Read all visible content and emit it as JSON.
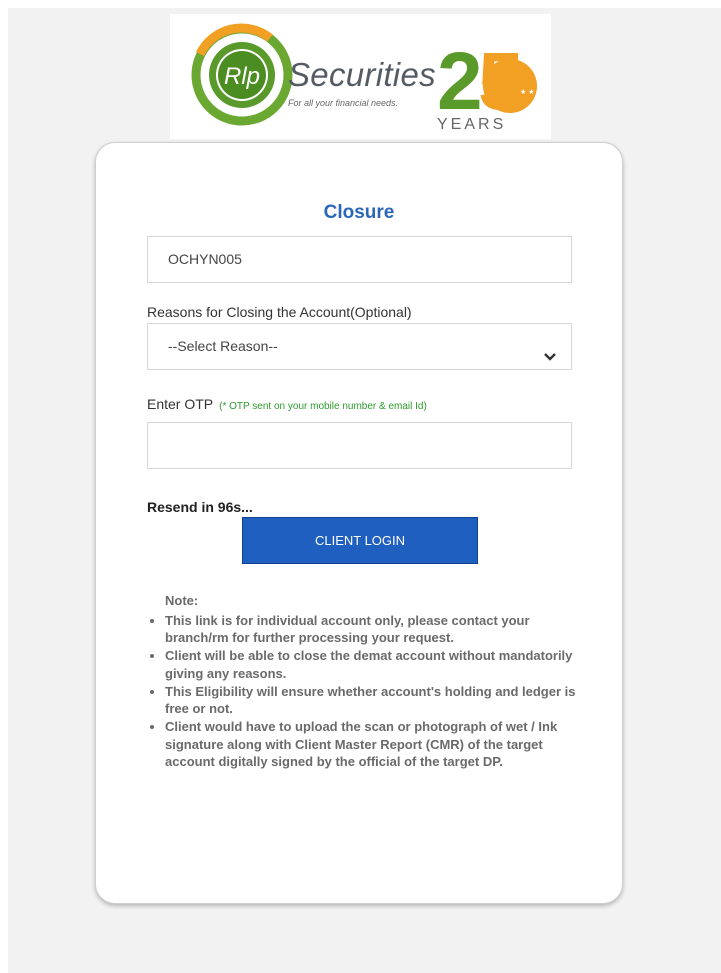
{
  "logo": {
    "brand": "Securities",
    "monogram": "Rlp",
    "tagline": "For all your financial needs.",
    "anniversary": "25",
    "years": "YEARS",
    "colors": {
      "green": "#5a9a2a",
      "orange": "#f2a024",
      "grey": "#555b63"
    }
  },
  "form": {
    "title": "Closure",
    "client_id": "OCHYN005",
    "reason_label": "Reasons for Closing the Account(Optional)",
    "reason_selected": "--Select Reason--",
    "otp_label": "Enter OTP",
    "otp_hint": "(* OTP sent on your mobile number & email Id)",
    "otp_value": "",
    "resend_text": "Resend in 96s...",
    "login_button": "CLIENT LOGIN"
  },
  "notes": {
    "heading": "Note:",
    "items": [
      "This link is for individual account only, please contact your branch/rm for further processing your request.",
      "Client will be able to close the demat account without mandatorily giving any reasons.",
      "This Eligibility will ensure whether account's holding and ledger is free or not.",
      "Client would have to upload the scan or photograph of wet / Ink signature along with Client Master Report (CMR) of the target account digitally signed by the official of the target DP."
    ]
  },
  "colors": {
    "accent": "#2c66b9",
    "button": "#1f5fbf",
    "hint": "#2e9a2e"
  }
}
